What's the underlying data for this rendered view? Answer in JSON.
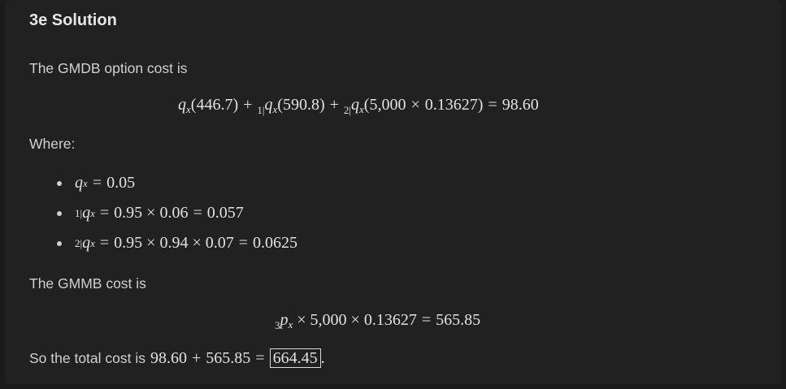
{
  "heading": "3e Solution",
  "intro": "The GMDB option cost is",
  "gmdb_equation": {
    "t1": "(446.7)",
    "t2": "(590.8)",
    "t3": "(5,000",
    "times": "×",
    "t3b": "0.13627)",
    "result": "98.60"
  },
  "where_label": "Where:",
  "bullets": [
    {
      "value": "0.05"
    },
    {
      "expr": "0.95 × 0.06",
      "value": "0.057"
    },
    {
      "expr": "0.95 × 0.94 × 0.07",
      "value": "0.0625"
    }
  ],
  "gmmb_label": "The GMMB cost is",
  "gmmb_equation": {
    "prefix": "3",
    "expr": "× 5,000 × 0.13627",
    "result": "565.85"
  },
  "total": {
    "label": "So the total cost is",
    "a": "98.60",
    "b": "565.85",
    "result": "664.45"
  }
}
